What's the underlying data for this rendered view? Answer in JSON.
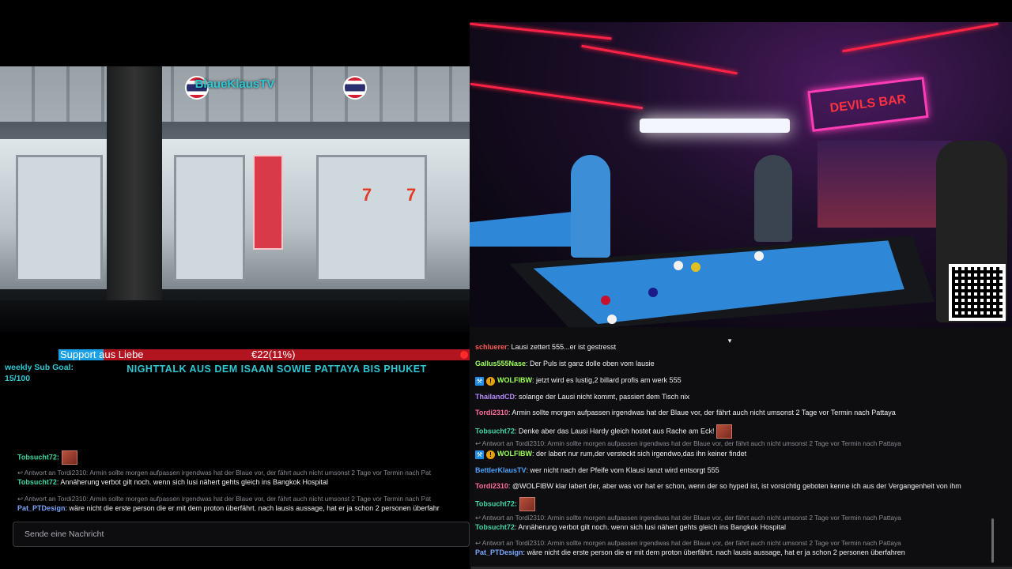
{
  "stream": {
    "title": "BlaueKlausTV",
    "left_video_description": "",
    "goal": {
      "label": "Support aus Liebe",
      "amount": "€22(11%)",
      "progress": 0.11
    },
    "sub_goal": {
      "line1": "weekly Sub Goal:",
      "line2": "15/100"
    },
    "ticker": "NIGHTTALK AUS DEM ISAAN SOWIE PATTAYA BIS PHUKET",
    "bar_sign": "DEVILS BAR"
  },
  "left_chat": {
    "messages": [
      {
        "user": "Tobsucht72:",
        "text": "",
        "user_color": "#3fd6a5",
        "has_emote": true
      },
      {
        "reply": "↩ Antwort an Tordi2310: Armin sollte morgen aufpassen irgendwas hat der Blaue vor, der fährt auch nicht umsonst 2 Tage vor Termin nach Pat"
      },
      {
        "user": "Tobsucht72",
        "text": ": Annäherung verbot gilt noch. wenn sich lusi nähert gehts gleich ins Bangkok Hospital",
        "user_color": "#3fd6a5"
      },
      {
        "reply": "↩ Antwort an Tordi2310: Armin sollte morgen aufpassen irgendwas hat der Blaue vor, der fährt auch nicht umsonst 2 Tage vor Termin nach Pat"
      },
      {
        "user": "Pat_PTDesign",
        "text": ": wäre nicht die erste person die er mit dem proton überfährt. nach lausis aussage, hat er ja schon 2 personen überfahr",
        "user_color": "#7aa8ff"
      }
    ],
    "input_placeholder": "Sende eine Nachricht"
  },
  "right_chat": {
    "collapse_icon": "▾",
    "messages": [
      {
        "user": "schluerer",
        "text": ": Lausi zettert 555...er ist gestresst",
        "user_color": "#ff5a5a"
      },
      {
        "user": "Gallus555Nase",
        "text": ": Der Puls ist ganz dolle oben vom lausie",
        "user_color": "#9bff5a"
      },
      {
        "user": "WOLFIBW",
        "text": ": jetzt wird es lustig,2 billard profis am werk 555",
        "user_color": "#9bff5a",
        "badges": true
      },
      {
        "user": "ThailandCD",
        "text": ": solange der Lausi nicht kommt, passiert dem Tisch nix",
        "user_color": "#b58cff"
      },
      {
        "user": "Tordi2310",
        "text": ": Armin sollte morgen aufpassen irgendwas hat der Blaue vor, der fährt auch nicht umsonst 2 Tage vor Termin nach Pattaya",
        "user_color": "#ff6b9a"
      },
      {
        "user": "Tobsucht72",
        "text": ": Denke aber das Lausi Hardy gleich hostet aus Rache am Eck!",
        "user_color": "#3fd6a5",
        "has_emote": true
      },
      {
        "reply": "↩ Antwort an Tordi2310: Armin sollte morgen aufpassen irgendwas hat der Blaue vor, der fährt auch nicht umsonst 2 Tage vor Termin nach Pattaya"
      },
      {
        "user": "WOLFIBW",
        "text": ": der labert nur rum,der versteckt sich irgendwo,das ihn keiner findet",
        "user_color": "#9bff5a",
        "badges": true
      },
      {
        "user": "BettlerKlausTV",
        "text": ": wer nicht nach der Pfeife vom Klausi tanzt wird entsorgt 555",
        "user_color": "#4aa3ff"
      },
      {
        "user": "Tordi2310",
        "text": ": @WOLFIBW klar labert der, aber was vor hat er schon, wenn der so hyped ist, ist vorsichtig geboten kenne ich aus der Vergangenheit von ihm",
        "user_color": "#ff6b9a"
      },
      {
        "user": "Tobsucht72:",
        "text": "",
        "user_color": "#3fd6a5",
        "has_emote": true
      },
      {
        "reply": "↩ Antwort an Tordi2310: Armin sollte morgen aufpassen irgendwas hat der Blaue vor, der fährt auch nicht umsonst 2 Tage vor Termin nach Pattaya"
      },
      {
        "user": "Tobsucht72",
        "text": ": Annäherung verbot gilt noch. wenn sich lusi nähert gehts gleich ins Bangkok Hospital",
        "user_color": "#3fd6a5"
      },
      {
        "reply": "↩ Antwort an Tordi2310: Armin sollte morgen aufpassen irgendwas hat der Blaue vor, der fährt auch nicht umsonst 2 Tage vor Termin nach Pattaya"
      },
      {
        "user": "Pat_PTDesign",
        "text": ": wäre nicht die erste person die er mit dem proton überfährt. nach lausis aussage, hat er ja schon 2 personen überfahren",
        "user_color": "#7aa8ff"
      }
    ]
  }
}
